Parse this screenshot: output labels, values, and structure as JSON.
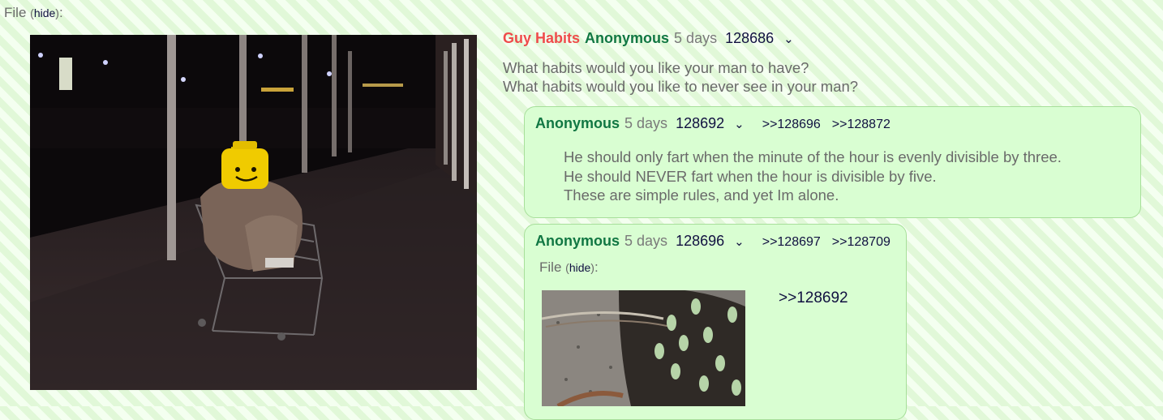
{
  "op": {
    "file_label": "File",
    "file_hide": "hide",
    "subject": "Guy Habits",
    "name": "Anonymous",
    "time": "5 days",
    "post_no": "128686",
    "chevron": "⌄",
    "body": [
      "What habits would you like your man to have?",
      "What habits would you like to never see in your man?"
    ]
  },
  "replies": [
    {
      "name": "Anonymous",
      "time": "5 days",
      "post_no": "128692",
      "chevron": "⌄",
      "backlinks": [
        ">>128696",
        ">>128872"
      ],
      "body": [
        "He should only fart when the minute of the hour is evenly divisible by three.",
        "He should NEVER fart when the hour is divisible by five.",
        "These are simple rules, and yet Im alone."
      ]
    },
    {
      "name": "Anonymous",
      "time": "5 days",
      "post_no": "128696",
      "chevron": "⌄",
      "backlinks": [
        ">>128697",
        ">>128709"
      ],
      "file_label": "File",
      "file_hide": "hide",
      "quote": ">>128692"
    }
  ],
  "colors": {
    "subject": "#ef4b4b",
    "name": "#117743",
    "link": "#101040",
    "reply_bg": "#d9fed2"
  }
}
